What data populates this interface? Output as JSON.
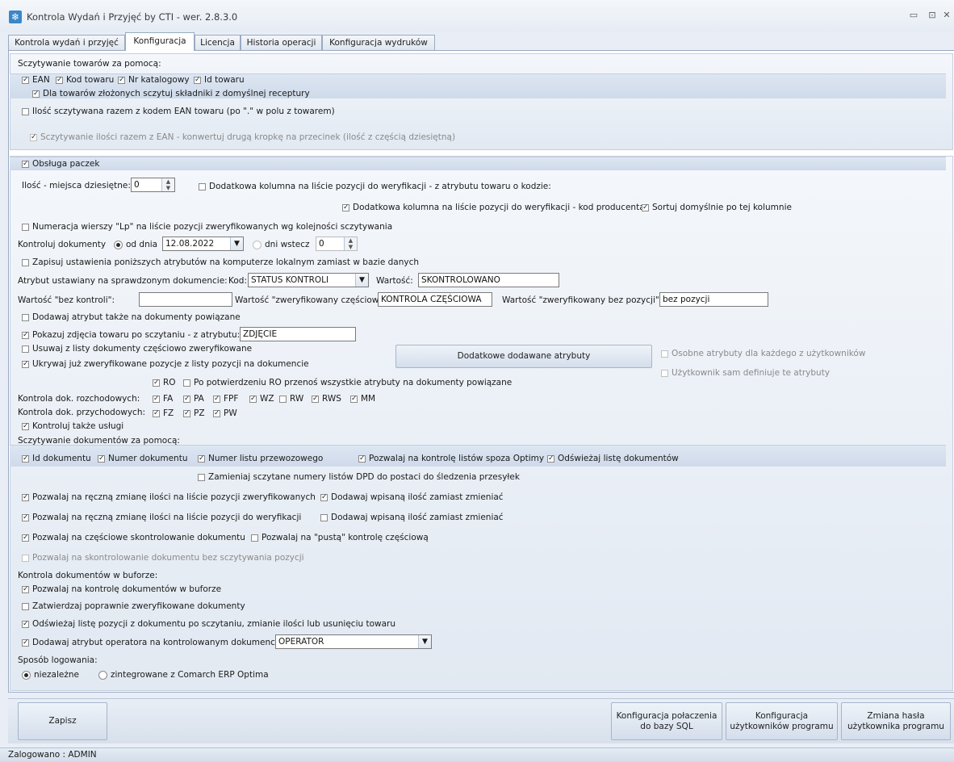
{
  "window": {
    "title": "Kontrola Wydań i Przyjęć by CTI -  wer. 2.8.3.0",
    "min_label": "▭",
    "max_label": "⊡",
    "close_label": "✕"
  },
  "tabs": [
    "Kontrola wydań i przyjęć",
    "Konfiguracja",
    "Licencja",
    "Historia operacji",
    "Konfiguracja wydruków"
  ],
  "scan": {
    "header": "Sczytywanie towarów za pomocą:",
    "ean": "EAN",
    "kod": "Kod towaru",
    "nrkat": "Nr katalogowy",
    "id": "Id towaru",
    "zlozone": "Dla towarów złożonych sczytuj składniki z domyślnej receptury",
    "ilosc_ean": "Ilość sczytywana razem z kodem EAN towaru (po \".\" w polu z towarem)",
    "konwertuj": "Sczytywanie ilości razem z EAN - konwertuj drugą kropkę na przecinek (ilość z częścią dziesiętną)"
  },
  "paczki": {
    "label": "Obsługa paczek"
  },
  "ilosc_miejsc": {
    "label": "Ilość - miejsca dziesiętne:",
    "value": "0"
  },
  "dodatkowa_kolumna_atrybut": "Dodatkowa kolumna na liście pozycji do weryfikacji - z atrybutu towaru o kodzie:",
  "dodatkowa_kolumna_producent": "Dodatkowa kolumna na liście pozycji do weryfikacji - kod producenta",
  "sortuj": "Sortuj domyślnie po tej kolumnie",
  "numeracja": "Numeracja wierszy \"Lp\" na liście pozycji zweryfikowanych wg kolejności sczytywania",
  "kontroluj_dok": {
    "label": "Kontroluj dokumenty",
    "od_dnia": "od dnia",
    "date": "12.08.2022",
    "dni_wstecz": "dni wstecz",
    "dni_value": "0"
  },
  "zapisuj_lokalnie": "Zapisuj ustawienia poniższych atrybutów na komputerze lokalnym zamiast w bazie danych",
  "atrybut": {
    "label": "Atrybut ustawiany na sprawdzonym dokumencie:",
    "kod_label": "Kod:",
    "kod_value": "STATUS KONTROLI",
    "wartosc_label": "Wartość:",
    "wartosc_value": "SKONTROLOWANO"
  },
  "wartosci": {
    "bez_kontroli_label": "Wartość \"bez kontroli\":",
    "bez_kontroli_value": "",
    "czesciowo_label": "Wartość \"zweryfikowany częściowo\":",
    "czesciowo_value": "KONTROLA CZĘŚCIOWA",
    "bez_pozycji_label": "Wartość \"zweryfikowany bez pozycji\":",
    "bez_pozycji_value": "bez pozycji"
  },
  "dodawaj_powiazane": "Dodawaj atrybut także na dokumenty powiązane",
  "zdjecia": {
    "label": "Pokazuj zdjęcia towaru po sczytaniu - z atrybutu:",
    "value": "ZDJĘCIE"
  },
  "dodatkowe_atrybuty_button": "Dodatkowe dodawane atrybuty",
  "osobne_atrybuty": "Osobne atrybuty dla każdego z użytkowników",
  "uzytkownik_definiuje": "Użytkownik sam definiuje te atrybuty",
  "usuwaj": "Usuwaj z listy dokumenty częściowo zweryfikowane",
  "ukrywaj": "Ukrywaj już zweryfikowane pozycje z listy pozycji na dokumencie",
  "ro": {
    "ro": "RO",
    "po_potwierdzeniu": "Po potwierdzeniu RO przenoś wszystkie atrybuty na dokumenty powiązane"
  },
  "rozchodowe": {
    "label": "Kontrola dok. rozchodowych:",
    "items": [
      "FA",
      "PA",
      "FPF",
      "WZ",
      "RW",
      "RWS",
      "MM"
    ]
  },
  "przychodowe": {
    "label": "Kontrola dok. przychodowych:",
    "items": [
      "FZ",
      "PZ",
      "PW"
    ]
  },
  "uslugi": "Kontroluj także usługi",
  "sczyt_dok": {
    "header": "Sczytywanie dokumentów za pomocą:",
    "id": "Id dokumentu",
    "numer": "Numer dokumentu",
    "list": "Numer listu przewozowego",
    "spoza": "Pozwalaj na kontrolę listów spoza Optimy",
    "odswiezaj": "Odświeżaj listę dokumentów",
    "dpd": "Zamieniaj sczytane numery listów DPD do postaci do śledzenia przesyłek"
  },
  "reczna_zweryf": "Pozwalaj na ręczną zmianę ilości na liście pozycji zweryfikowanych",
  "dodawaj_wpisana1": "Dodawaj wpisaną ilość zamiast zmieniać",
  "reczna_do_weryf": "Pozwalaj na ręczną zmianę ilości na liście pozycji do weryfikacji",
  "dodawaj_wpisana2": "Dodawaj wpisaną ilość zamiast zmieniać",
  "czesciowe": "Pozwalaj na częściowe skontrolowanie dokumentu",
  "pusta": "Pozwalaj na \"pustą\" kontrolę częściową",
  "bez_sczytywania": "Pozwalaj na skontrolowanie dokumentu bez sczytywania pozycji",
  "bufor": {
    "header": "Kontrola dokumentów w buforze:",
    "pozwalaj": "Pozwalaj na kontrolę dokumentów w buforze"
  },
  "zatwierdzaj": "Zatwierdzaj poprawnie zweryfikowane dokumenty",
  "odswiezaj_pozycje": "Odświeżaj listę pozycji z dokumentu po sczytaniu, zmianie ilości lub usunięciu towaru",
  "operator": {
    "label": "Dodawaj atrybut operatora na kontrolowanym dokumencie",
    "value": "OPERATOR"
  },
  "logowanie": {
    "header": "Sposób logowania:",
    "niezalezne": "niezależne",
    "zintegrowane": "zintegrowane z Comarch ERP Optima"
  },
  "buttons": {
    "zapisz": "Zapisz",
    "sql": "Konfiguracja połaczenia\ndo bazy SQL",
    "uzytkownicy": "Konfiguracja\nużytkowników programu",
    "haslo": "Zmiana hasła\nużytkownika programu"
  },
  "status": "Zalogowano : ADMIN"
}
